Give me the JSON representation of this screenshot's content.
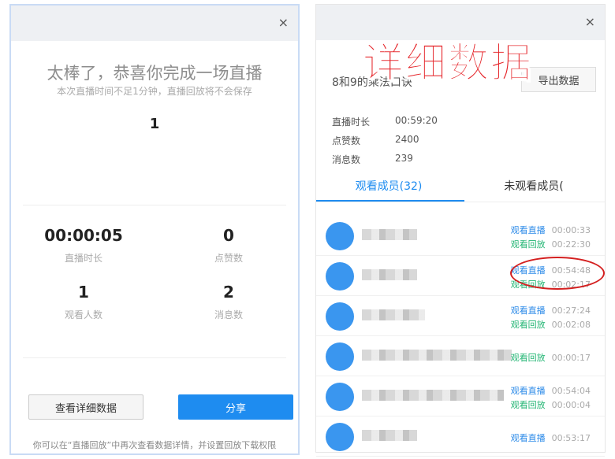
{
  "left": {
    "title": "太棒了，恭喜你完成一场直播",
    "subtitle": "本次直播时间不足1分钟，直播回放将不会保存",
    "top_value": "1",
    "stats": [
      {
        "value": "00:00:05",
        "label": "直播时长"
      },
      {
        "value": "0",
        "label": "点赞数"
      },
      {
        "value": "1",
        "label": "观看人数"
      },
      {
        "value": "2",
        "label": "消息数"
      }
    ],
    "detail_button": "查看详细数据",
    "share_button": "分享",
    "footer": "你可以在“直播回放”中再次查看数据详情，并设置回放下载权限",
    "close": "×"
  },
  "annotation": "详细数据",
  "right": {
    "close": "×",
    "title": "8和9的乘法口诀",
    "export_button": "导出数据",
    "info": [
      {
        "label": "直播时长",
        "value": "00:59:20"
      },
      {
        "label": "点赞数",
        "value": "2400"
      },
      {
        "label": "消息数",
        "value": "239"
      }
    ],
    "tabs": [
      "观看成员(32)",
      "未观看成员("
    ],
    "members": [
      {
        "actions": [
          {
            "type": "观看直播",
            "time": "00:00:33"
          },
          {
            "type": "观看回放",
            "time": "00:22:30"
          }
        ]
      },
      {
        "actions": [
          {
            "type": "观看直播",
            "time": "00:54:48"
          },
          {
            "type": "观看回放",
            "time": "00:02:17"
          }
        ]
      },
      {
        "actions": [
          {
            "type": "观看直播",
            "time": "00:27:24"
          },
          {
            "type": "观看回放",
            "time": "00:02:08"
          }
        ]
      },
      {
        "actions": [
          {
            "type": "观看回放",
            "time": "00:00:17"
          }
        ]
      },
      {
        "actions": [
          {
            "type": "观看直播",
            "time": "00:54:04"
          },
          {
            "type": "观看回放",
            "time": "00:00:04"
          }
        ]
      },
      {
        "actions": [
          {
            "type": "观看直播",
            "time": "00:53:17"
          }
        ]
      }
    ]
  },
  "colors": {
    "accent": "#1e8cf0",
    "live": "#2b8ae8",
    "replay": "#22b573",
    "highlight": "#d42020"
  }
}
